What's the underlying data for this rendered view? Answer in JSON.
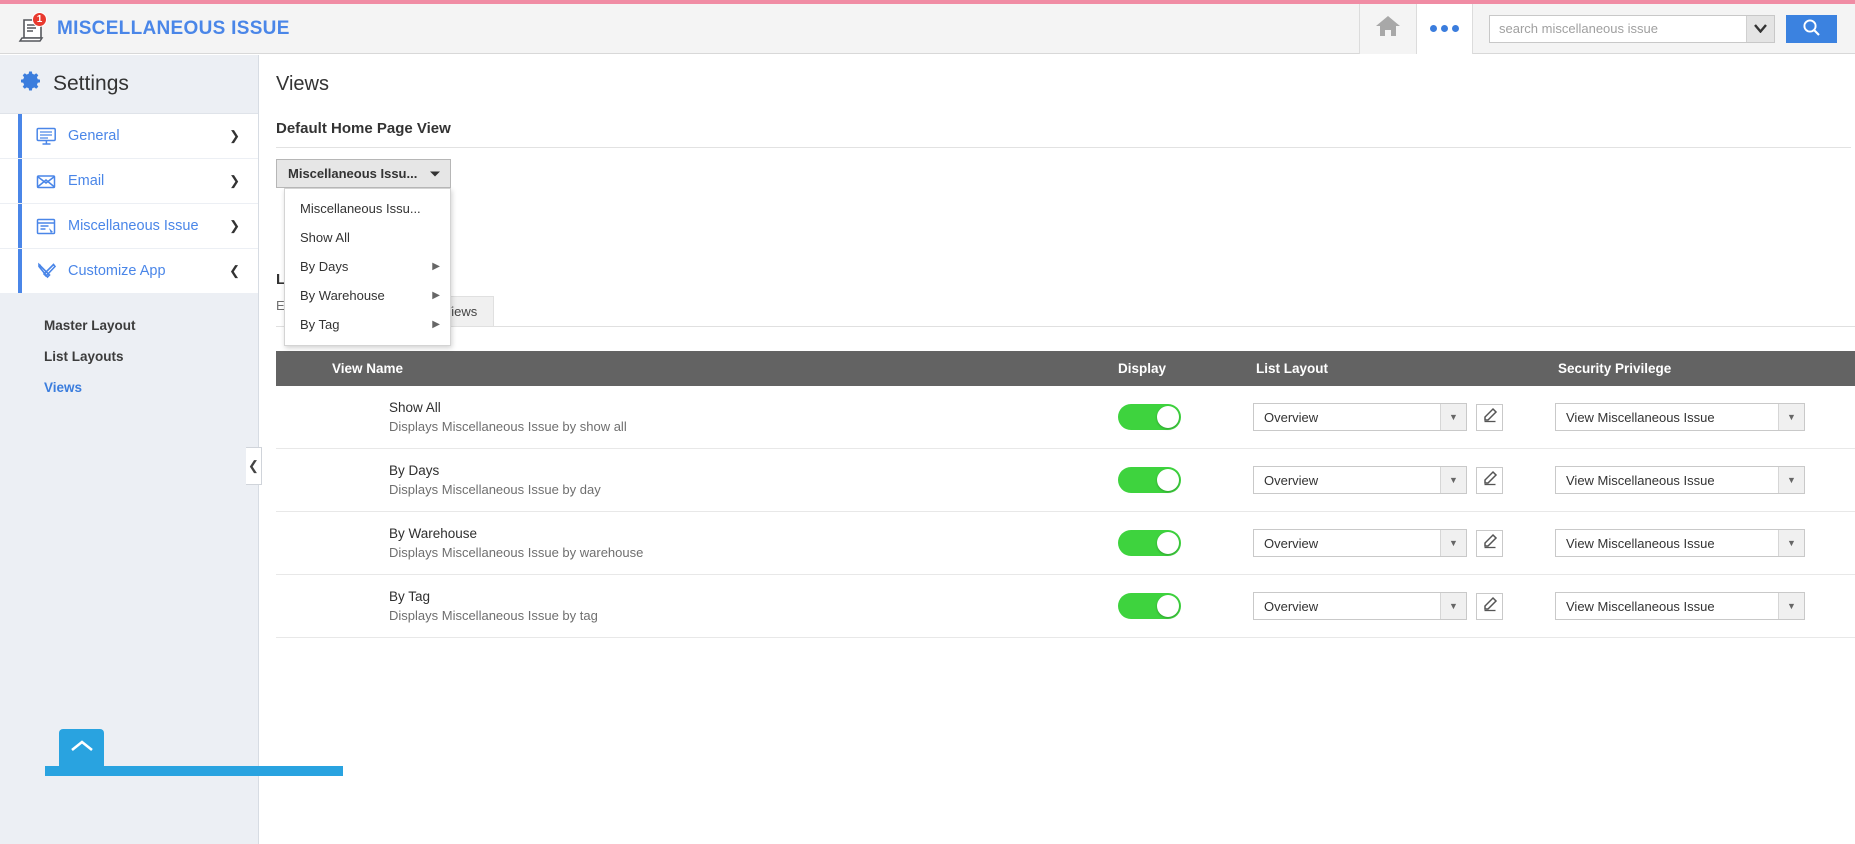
{
  "header": {
    "app_title": "MISCELLANEOUS ISSUE",
    "badge_count": "1",
    "app_icon": "document-alert-icon",
    "home_icon": "home-icon",
    "more_icon": "more-dots-icon",
    "search_placeholder": "search miscellaneous issue",
    "search_value": "",
    "search_caret_icon": "chevron-down-icon",
    "search_button_icon": "search-icon"
  },
  "sidebar": {
    "title": "Settings",
    "gear_icon": "gear-icon",
    "items": [
      {
        "label": "General",
        "icon": "monitor-icon",
        "chevron": "❯"
      },
      {
        "label": "Email",
        "icon": "envelope-icon",
        "chevron": "❯"
      },
      {
        "label": "Miscellaneous Issue",
        "icon": "form-window-icon",
        "chevron": "❯"
      },
      {
        "label": "Customize App",
        "icon": "tools-icon",
        "chevron": "❯"
      }
    ],
    "sub_items": [
      {
        "label": "Master Layout",
        "active": false
      },
      {
        "label": "List Layouts",
        "active": false
      },
      {
        "label": "Views",
        "active": true
      }
    ],
    "collapse_icon": "chevron-left-icon",
    "scroll_top_icon": "chevron-up-icon"
  },
  "main": {
    "page_title": "Views",
    "default_home_section_title": "Default Home Page View",
    "home_select_value": "Miscellaneous Issu...",
    "home_select_caret": "caret-down-icon",
    "dropdown_items": [
      {
        "label": "Miscellaneous Issu...",
        "has_submenu": false
      },
      {
        "label": "Show All",
        "has_submenu": false
      },
      {
        "label": "By Days",
        "has_submenu": true
      },
      {
        "label": "By Warehouse",
        "has_submenu": true
      },
      {
        "label": "By Tag",
        "has_submenu": true
      }
    ],
    "submenu_arrow": "▶",
    "list_views_section_title": "List Views",
    "list_views_description": "Enable or disable left panel views.",
    "tab_label": "List Views"
  },
  "table": {
    "columns": [
      "View Name",
      "Display",
      "List Layout",
      "Security Privilege"
    ],
    "rows": [
      {
        "name": "Show All",
        "description": "Displays Miscellaneous Issue by show all",
        "display_on": true,
        "list_layout": "Overview",
        "security_privilege": "View Miscellaneous Issue",
        "edit_icon": "pencil-icon"
      },
      {
        "name": "By Days",
        "description": "Displays Miscellaneous Issue by day",
        "display_on": true,
        "list_layout": "Overview",
        "security_privilege": "View Miscellaneous Issue",
        "edit_icon": "pencil-icon"
      },
      {
        "name": "By Warehouse",
        "description": "Displays Miscellaneous Issue by warehouse",
        "display_on": true,
        "list_layout": "Overview",
        "security_privilege": "View Miscellaneous Issue",
        "edit_icon": "pencil-icon"
      },
      {
        "name": "By Tag",
        "description": "Displays Miscellaneous Issue by tag",
        "display_on": true,
        "list_layout": "Overview",
        "security_privilege": "View Miscellaneous Issue",
        "edit_icon": "pencil-icon"
      }
    ]
  },
  "colors": {
    "accent_blue": "#4a86e8",
    "top_strip_pink": "#f08ca4",
    "toggle_green": "#3ed33e",
    "table_header_gray": "#636363",
    "search_button_blue": "#3b82e0",
    "scroll_button_blue": "#29a3e0",
    "badge_red": "#e8392e"
  }
}
